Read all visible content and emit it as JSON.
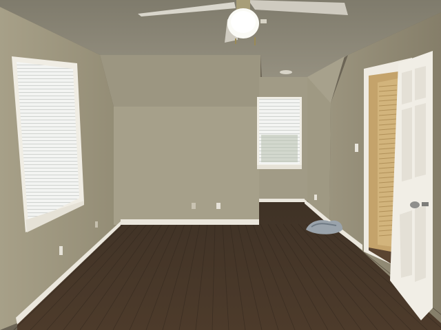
{
  "scene": {
    "subject": "empty-bedroom-interior",
    "colors": {
      "wall_left": "#9e9780",
      "wall_back": "#a39d87",
      "wall_alcove": "#a8a18b",
      "wall_right": "#958e78",
      "ceiling": "#8a8676",
      "sloped_ceiling": "#9a9480",
      "floor": "#4a3a2c",
      "trim": "#ece8de",
      "door": "#f2efe8",
      "closet_wood": "#c9a86e",
      "window_light": "#f4f5f3"
    },
    "objects": [
      {
        "name": "ceiling-fan",
        "kind": "fixture"
      },
      {
        "name": "window-left",
        "kind": "window",
        "blinds": true
      },
      {
        "name": "window-back",
        "kind": "window",
        "blinds": true
      },
      {
        "name": "open-door",
        "kind": "door",
        "panels": 6
      },
      {
        "name": "closet-louvered-door",
        "kind": "door"
      },
      {
        "name": "hardwood-floor",
        "kind": "floor"
      },
      {
        "name": "cloth-pile",
        "kind": "item"
      }
    ]
  }
}
